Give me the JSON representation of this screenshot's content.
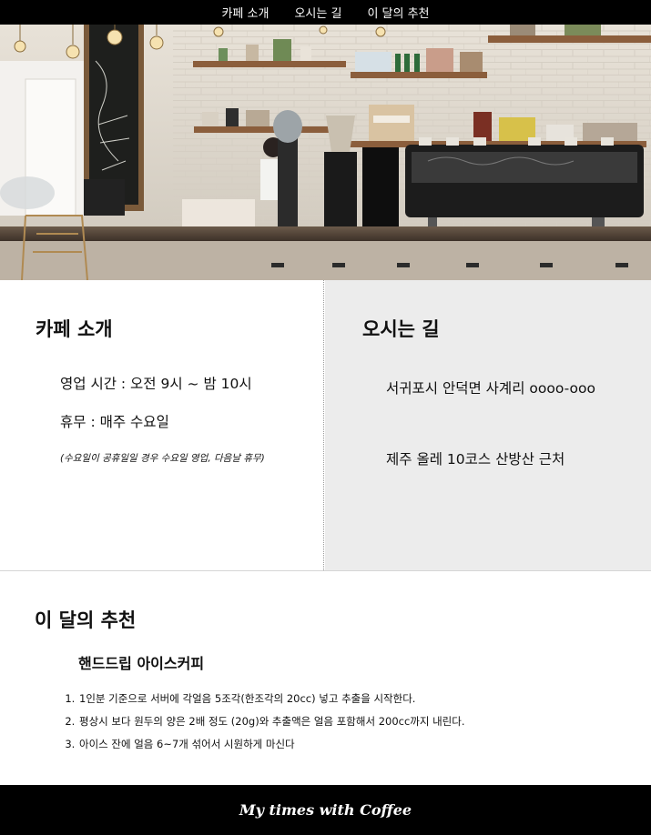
{
  "nav": {
    "items": [
      {
        "label": "카페 소개"
      },
      {
        "label": "오시는 길"
      },
      {
        "label": "이 달의 추천"
      }
    ]
  },
  "hero": {
    "alt": "cafe interior photo with espresso machine and grinders"
  },
  "about": {
    "title": "카페 소개",
    "hours": "영업 시간 : 오전 9시 ~ 밤 10시",
    "closed": "휴무 : 매주 수요일",
    "note": "(수요일이 공휴일일 경우 수요일 영업, 다음날 휴무)"
  },
  "directions": {
    "title": "오시는 길",
    "address": "서귀포시 안덕면 사계리 oooo-ooo",
    "landmark": "제주 올레 10코스 산방산 근처"
  },
  "recommend": {
    "title": "이 달의 추천",
    "menu_name": "핸드드립 아이스커피",
    "steps": [
      "1인분 기준으로 서버에 각얼음 5조각(한조각의 20cc) 넣고 추출을 시작한다.",
      "평상시 보다 원두의 양은 2배 정도 (20g)와 추출액은 얼음 포함해서 200cc까지 내린다.",
      "아이스 잔에 얼음 6~7개 섞어서 시원하게 마신다"
    ]
  },
  "footer": {
    "text": "My times with Coffee"
  },
  "colors": {
    "nav_bg": "#000000",
    "right_panel_bg": "#ececec",
    "footer_bg": "#000000"
  }
}
